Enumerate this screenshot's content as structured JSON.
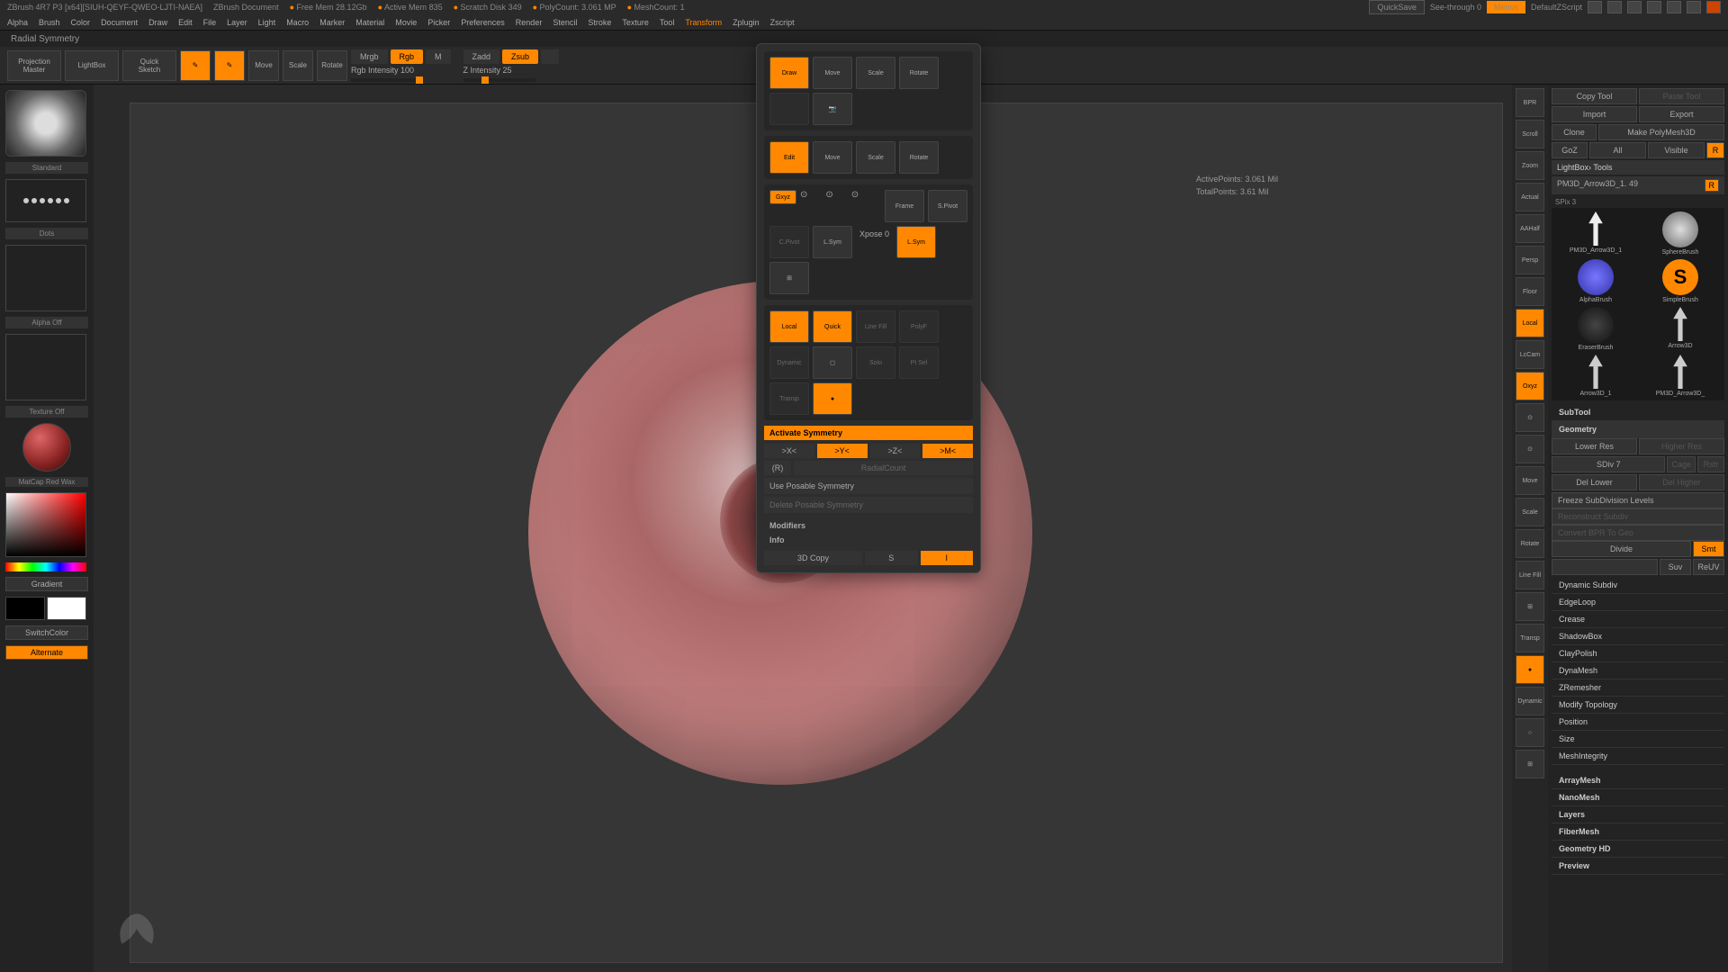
{
  "topbar": {
    "title": "ZBrush 4R7 P3 [x64][SIUH-QEYF-QWEO-LJTI-NAEA]",
    "doc": "ZBrush Document",
    "freemem_label": "Free Mem",
    "freemem": "28.12Gb",
    "activemem_label": "Active Mem",
    "activemem": "835",
    "scratch_label": "Scratch Disk",
    "scratch": "349",
    "polycount_label": "PolyCount:",
    "polycount": "3.061 MP",
    "meshcount_label": "MeshCount:",
    "meshcount": "1",
    "quicksave": "QuickSave",
    "seethrough": "See-through",
    "seethrough_val": "0",
    "menus": "Menus",
    "script": "DefaultZScript"
  },
  "menubar": {
    "items": [
      "Alpha",
      "Brush",
      "Color",
      "Document",
      "Draw",
      "Edit",
      "File",
      "Layer",
      "Light",
      "Macro",
      "Marker",
      "Material",
      "Movie",
      "Picker",
      "Preferences",
      "Render",
      "Stencil",
      "Stroke",
      "Texture",
      "Tool",
      "Transform",
      "Zplugin",
      "Zscript"
    ],
    "active": "Transform"
  },
  "status": "Radial Symmetry",
  "toolbar": {
    "projection": "Projection\nMaster",
    "lightbox": "LightBox",
    "quicksketch": "Quick\nSketch",
    "edit": "Edit",
    "draw": "Draw",
    "move": "Move",
    "scale": "Scale",
    "rotate": "Rotate",
    "mrgb": "Mrgb",
    "rgb": "Rgb",
    "m": "M",
    "rgb_intensity": "Rgb Intensity 100",
    "zadd": "Zadd",
    "zsub": "Zsub",
    "zcut": "",
    "z_intensity": "Z Intensity 25"
  },
  "info": {
    "active_points": "ActivePoints: 3.061 Mil",
    "total_points": "TotalPoints: 3.61 Mil"
  },
  "left": {
    "brush": "Standard",
    "stroke": "Dots",
    "alpha": "Alpha Off",
    "texture": "Texture Off",
    "material": "MatCap Red Wax",
    "gradient": "Gradient",
    "switchcolor": "SwitchColor",
    "alternate": "Alternate"
  },
  "panel": {
    "draw": "Draw",
    "move": "Move",
    "scale": "Scale",
    "rotate": "Rotate",
    "edit": "Edit",
    "gxyz": "Gxyz",
    "frame": "Frame",
    "spivot": "S.Pivot",
    "cpivot": "C.Pivot",
    "lsym": "L.Sym",
    "lsym2": "L.Sym",
    "xpose_label": "Xpose",
    "xpose_val": "0",
    "local": "Local",
    "quick": "Quick",
    "linefill": "Line Fill",
    "polyf": "PolyF",
    "solo": "Solo",
    "ptsel": "Pt Sel",
    "transp": "Transp",
    "dynamic": "Dynamic",
    "activate_symmetry": "Activate Symmetry",
    "x": ">X<",
    "y": ">Y<",
    "z": ">Z<",
    "m": ">M<",
    "r": "(R)",
    "radial_count": "RadialCount",
    "posable": "Use Posable Symmetry",
    "delete_posable": "Delete Posable Symmetry",
    "modifiers": "Modifiers",
    "info_label": "Info",
    "copy3d": "3D Copy",
    "copy_s": "S",
    "copy_i": "I"
  },
  "rightTools": [
    "BPR",
    "Scroll",
    "Zoom",
    "Actual",
    "AAHalf",
    "Persp",
    "Floor",
    "Local",
    "LcCam",
    "Oxyz",
    "",
    "",
    "Move",
    "Scale",
    "Rotate",
    "Line Fill",
    "",
    "Transp",
    "",
    "Dynamic",
    ""
  ],
  "rightPanel": {
    "copytool": "Copy Tool",
    "pastetool": "Paste Tool",
    "import": "Import",
    "export": "Export",
    "clone": "Clone",
    "make": "Make PolyMesh3D",
    "goz": "GoZ",
    "all": "All",
    "visible": "Visible",
    "r": "R",
    "lightbox_tools": "LightBox› Tools",
    "current_tool": "PM3D_Arrow3D_1. 49",
    "current_tool_r": "R",
    "sp3": "SPix 3",
    "tools": [
      {
        "label": "PM3D_Arrow3D_1"
      },
      {
        "label": "SphereBrush"
      },
      {
        "label": "AlphaBrush"
      },
      {
        "label": "SimpleBrush"
      },
      {
        "label": "EraserBrush"
      },
      {
        "label": "Arrow3D"
      },
      {
        "label": "Arrow3D_1"
      },
      {
        "label": "PM3D_Arrow3D_"
      }
    ],
    "subtool": "SubTool",
    "geometry": "Geometry",
    "lower_res": "Lower Res",
    "higher_res": "Higher Res",
    "sdiv": "SDiv 7",
    "cage": "Cage",
    "rstr": "Rstr",
    "del_lower": "Del Lower",
    "del_higher": "Del Higher",
    "freeze": "Freeze SubDivision Levels",
    "reconstruct": "Reconstruct Subdiv",
    "convert": "Convert BPR To Geo",
    "divide": "Divide",
    "smt": "Smt",
    "suv": "Suv",
    "reuv": "ReUV",
    "sections": [
      "Dynamic Subdiv",
      "EdgeLoop",
      "Crease",
      "ShadowBox",
      "ClayPolish",
      "DynaMesh",
      "ZRemesher",
      "Modify Topology",
      "Position",
      "Size",
      "MeshIntegrity"
    ],
    "sections2": [
      "ArrayMesh",
      "NanoMesh",
      "Layers",
      "FiberMesh",
      "Geometry HD",
      "Preview"
    ]
  }
}
